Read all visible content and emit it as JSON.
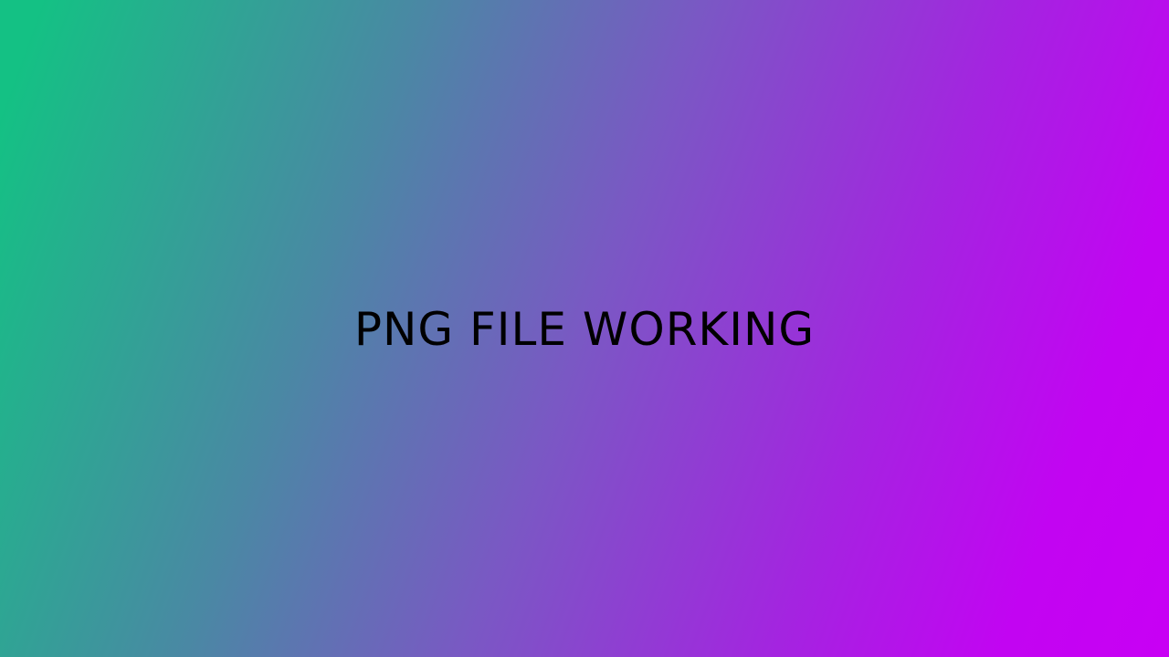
{
  "message": "PNG FILE WORKING",
  "colors": {
    "gradient_start": "#14c184",
    "gradient_end": "#c800f4",
    "text": "#000000"
  }
}
